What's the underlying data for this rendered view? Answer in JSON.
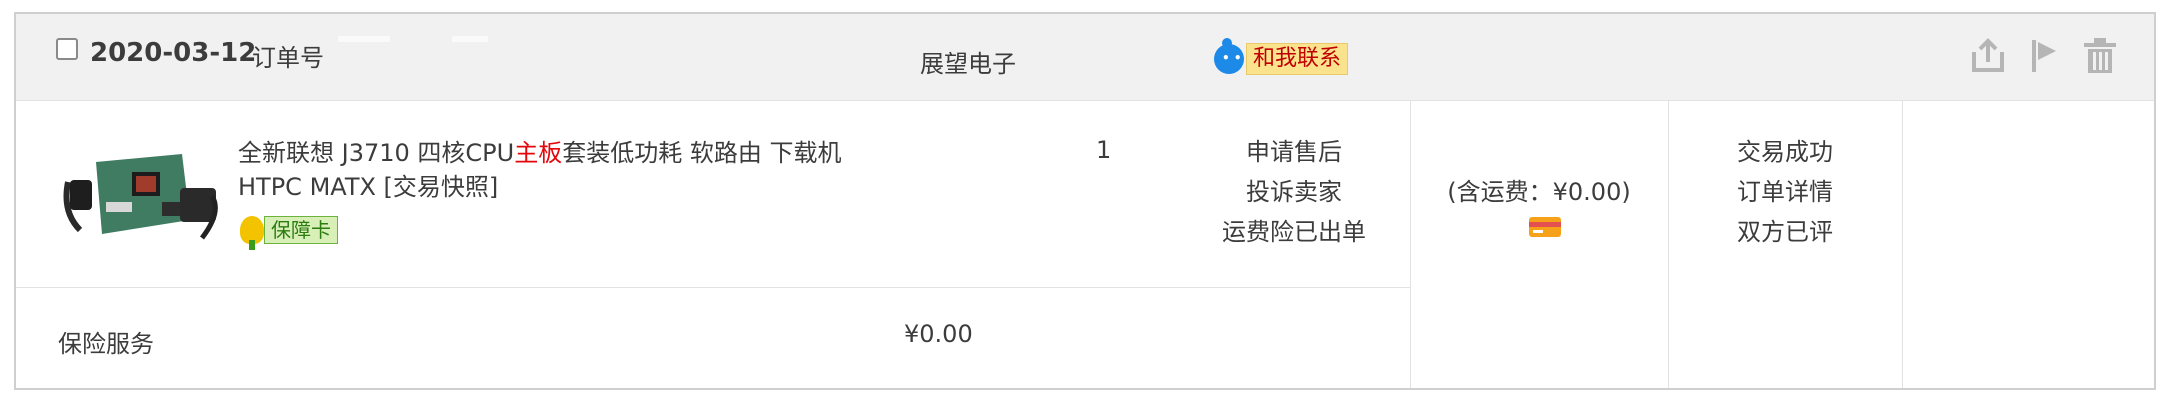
{
  "order": {
    "date": "2020-03-12",
    "order_number_label": "订单号",
    "shop_name": "展望电子",
    "contact_label": "和我联系",
    "header_icons": [
      "share-icon",
      "flag-icon",
      "trash-icon"
    ]
  },
  "item": {
    "title_before": "全新联想 J3710 四核CPU",
    "title_highlight": "主板",
    "title_after": "套装低功耗 软路由 下载机 HTPC MATX [交易快照]",
    "badge": "保障卡",
    "quantity": "1",
    "operations": [
      "申请售后",
      "投诉卖家",
      "运费险已出单"
    ]
  },
  "payment": {
    "shipping_text": "(含运费：¥0.00)",
    "card_icon": "credit-card-icon"
  },
  "status": {
    "items": [
      "交易成功",
      "订单详情",
      "双方已评"
    ]
  },
  "insurance": {
    "label": "保险服务",
    "price": "¥0.00"
  },
  "colors": {
    "header_bg": "#f1f1f1",
    "border": "#cfcfcf",
    "highlight": "#e4060b",
    "contact_blue": "#1d8ae8"
  }
}
